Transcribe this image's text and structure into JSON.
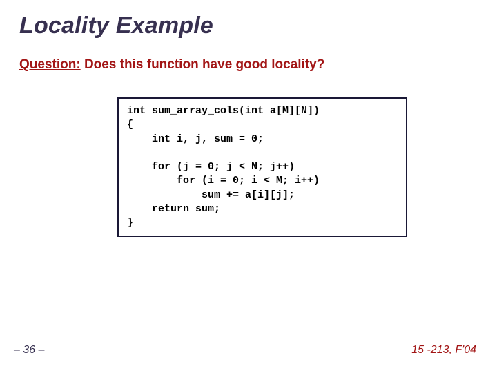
{
  "title": "Locality Example",
  "question_label": "Question:",
  "question_rest": " Does this function have good locality?",
  "code": "int sum_array_cols(int a[M][N])\n{\n    int i, j, sum = 0;\n\n    for (j = 0; j < N; j++)\n        for (i = 0; i < M; i++)\n            sum += a[i][j];\n    return sum;\n}",
  "footer_left": "– 36 –",
  "footer_right": "15 -213, F'04"
}
